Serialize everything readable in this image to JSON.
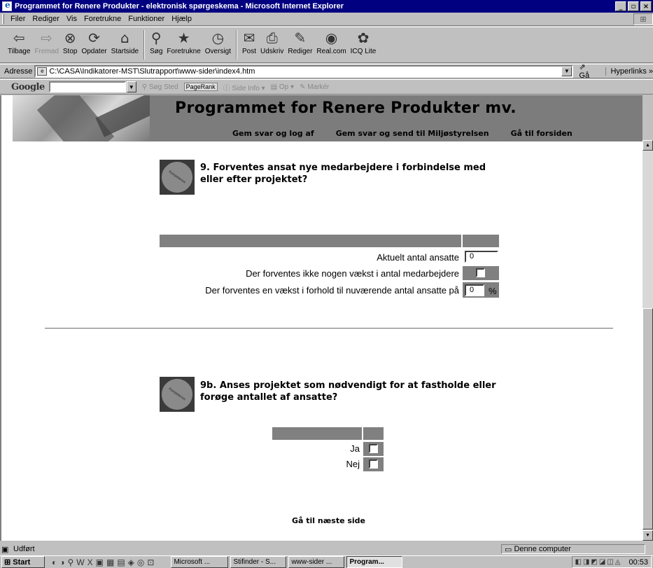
{
  "window": {
    "title": "Programmet for Renere Produkter - elektronisk spørgeskema - Microsoft Internet Explorer",
    "btn_min": "_",
    "btn_max": "▫",
    "btn_close": "×"
  },
  "menu": [
    "Filer",
    "Rediger",
    "Vis",
    "Foretrukne",
    "Funktioner",
    "Hjælp"
  ],
  "toolbar": [
    {
      "label": "Tilbage",
      "icon": "back-arrow-icon",
      "glyph": "⇦"
    },
    {
      "label": "Fremad",
      "icon": "forward-arrow-icon",
      "glyph": "⇨"
    },
    {
      "label": "Stop",
      "icon": "stop-icon",
      "glyph": "⊗"
    },
    {
      "label": "Opdater",
      "icon": "refresh-icon",
      "glyph": "⟳"
    },
    {
      "label": "Startside",
      "icon": "home-icon",
      "glyph": "⌂"
    },
    {
      "label": "Søg",
      "icon": "search-icon",
      "glyph": "⚲"
    },
    {
      "label": "Foretrukne",
      "icon": "favorites-icon",
      "glyph": "★"
    },
    {
      "label": "Oversigt",
      "icon": "history-icon",
      "glyph": "◷"
    },
    {
      "label": "Post",
      "icon": "mail-icon",
      "glyph": "✉"
    },
    {
      "label": "Udskriv",
      "icon": "print-icon",
      "glyph": "⎙"
    },
    {
      "label": "Rediger",
      "icon": "edit-icon",
      "glyph": "✎"
    },
    {
      "label": "Real.com",
      "icon": "realcom-icon",
      "glyph": "◉"
    },
    {
      "label": "ICQ Lite",
      "icon": "icq-icon",
      "glyph": "✿"
    }
  ],
  "address": {
    "label": "Adresse",
    "url": "C:\\CASA\\Indikatorer-MST\\Slutrapport\\www-sider\\index4.htm",
    "go": "Gå",
    "links": "Hyperlinks »"
  },
  "google": {
    "logo": "Google",
    "search_site": "Søg Sted",
    "pagerank": "PageRank",
    "page_info": "Side Info",
    "up": "Op",
    "highlight": "Markér"
  },
  "banner": {
    "title": "Programmet for Renere Produkter mv.",
    "nav": [
      "Gem svar og log af",
      "Gem svar og send til Miljøstyrelsen",
      "Gå til forsiden"
    ]
  },
  "questions": {
    "q9": {
      "text": "9. Forventes ansat nye medarbejdere i forbindelse med eller efter projektet?",
      "rows": {
        "current": "Aktuelt antal ansatte",
        "current_value": "0",
        "no_growth": "Der forventes ikke nogen vækst i antal medarbejdere",
        "growth": "Der forventes en vækst i forhold til nuværende antal ansatte på",
        "growth_value": "0",
        "pct": "%"
      }
    },
    "q9b": {
      "text": "9b. Anses projektet som nødvendigt for at fastholde eller forøge antallet af ansatte?",
      "yes": "Ja",
      "no": "Nej"
    }
  },
  "next_link": "Gå til næste side",
  "status": {
    "text": "Udført",
    "zone": "Denne computer"
  },
  "taskbar": {
    "start": "Start",
    "tasks": [
      "Microsoft ...",
      "Stifinder - S...",
      "www-sider ...",
      "Program..."
    ],
    "clock": "00:53"
  }
}
